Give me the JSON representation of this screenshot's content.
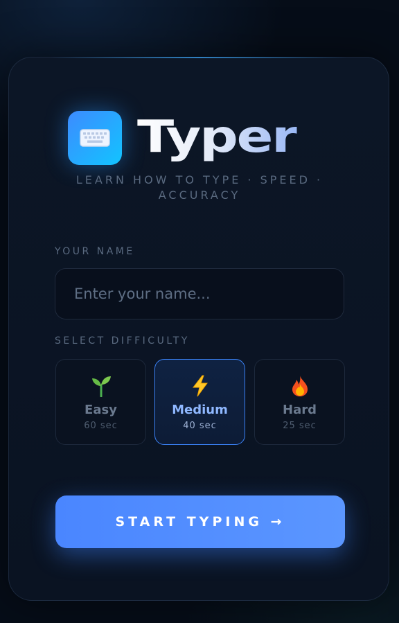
{
  "brand": {
    "icon": "keyboard-icon",
    "title": "Typer",
    "tagline": "LEARN HOW TO TYPE · SPEED · ACCURACY"
  },
  "name_field": {
    "label": "YOUR NAME",
    "placeholder": "Enter your name...",
    "value": ""
  },
  "difficulty": {
    "label": "SELECT DIFFICULTY",
    "selected": "Medium",
    "options": [
      {
        "icon": "seedling-icon",
        "name": "Easy",
        "time": "60 sec"
      },
      {
        "icon": "lightning-icon",
        "name": "Medium",
        "time": "40 sec"
      },
      {
        "icon": "fire-icon",
        "name": "Hard",
        "time": "25 sec"
      }
    ]
  },
  "start_button": {
    "label": "START TYPING →"
  },
  "colors": {
    "accent": "#4a86ff",
    "logo_gradient_start": "#3d8bff",
    "logo_gradient_end": "#12c4ff",
    "background": "#060d18",
    "card": "#0b1524"
  }
}
